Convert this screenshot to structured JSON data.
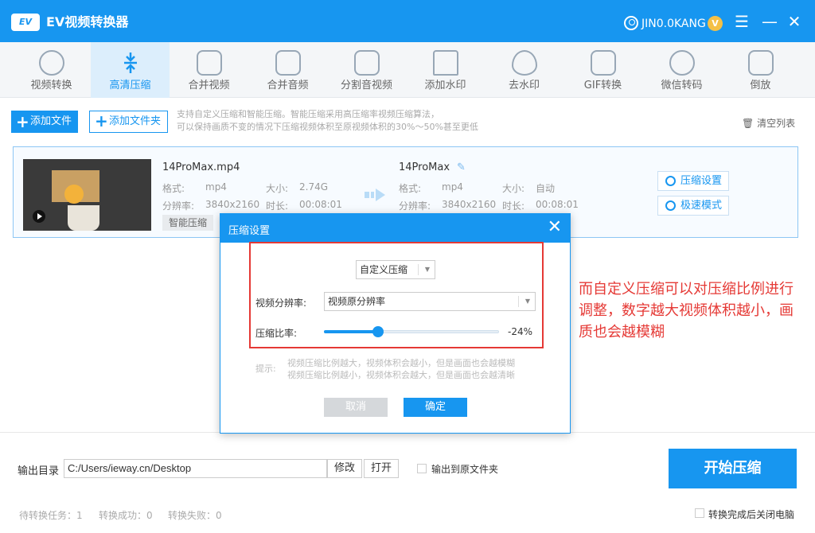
{
  "app": {
    "logo": "EV",
    "title": "EV视频转换器",
    "username": "JIN0.0KANG",
    "vip": "V"
  },
  "toolbar": {
    "items": [
      {
        "label": "视频转换",
        "icon": "video-convert-icon"
      },
      {
        "label": "高清压缩",
        "icon": "compress-icon"
      },
      {
        "label": "合并视频",
        "icon": "merge-video-icon"
      },
      {
        "label": "合并音频",
        "icon": "merge-audio-icon"
      },
      {
        "label": "分割音视频",
        "icon": "split-icon"
      },
      {
        "label": "添加水印",
        "icon": "watermark-add-icon"
      },
      {
        "label": "去水印",
        "icon": "watermark-remove-icon"
      },
      {
        "label": "GIF转换",
        "icon": "gif-icon"
      },
      {
        "label": "微信转码",
        "icon": "wechat-icon"
      },
      {
        "label": "倒放",
        "icon": "reverse-icon"
      }
    ],
    "active_index": 1
  },
  "actions": {
    "add_file": "添加文件",
    "add_folder": "添加文件夹",
    "desc_line1": "支持自定义压缩和智能压缩。智能压缩采用高压缩率视频压缩算法，",
    "desc_line2": "可以保持画质不变的情况下压缩视频体积至原视频体积的30%～50%甚至更低",
    "clear_list": "清空列表"
  },
  "file": {
    "source": {
      "name": "14ProMax.mp4",
      "format_label": "格式:",
      "format": "mp4",
      "size_label": "大小:",
      "size": "2.74G",
      "resolution_label": "分辨率:",
      "resolution": "3840x2160",
      "duration_label": "时长:",
      "duration": "00:08:01"
    },
    "mode_tag": "智能压缩",
    "output": {
      "name": "14ProMax",
      "format_label": "格式:",
      "format": "mp4",
      "size_label": "大小:",
      "size": "自动",
      "resolution_label": "分辨率:",
      "resolution": "3840x2160",
      "duration_label": "时长:",
      "duration": "00:08:01"
    },
    "compress_settings_btn": "压缩设置",
    "fast_mode_btn": "极速模式"
  },
  "dialog": {
    "title": "压缩设置",
    "mode_select": "自定义压缩",
    "resolution_label": "视频分辨率:",
    "resolution_value": "视频原分辨率",
    "ratio_label": "压缩比率:",
    "ratio_value": "-24%",
    "ratio_fraction": 0.31,
    "tip_label": "提示:",
    "tip_line1": "视频压缩比例越大，视频体积会越小，但是画面也会越模糊",
    "tip_line2": "视频压缩比例越小，视频体积会越大，但是画面也会越清晰",
    "cancel": "取消",
    "confirm": "确定"
  },
  "annotation": "而自定义压缩可以对压缩比例进行调整，数字越大视频体积越小，画质也会越模糊",
  "bottom": {
    "output_dir_label": "输出目录",
    "output_dir_value": "C:/Users/ieway.cn/Desktop",
    "modify": "修改",
    "open": "打开",
    "to_source_folder": "输出到原文件夹",
    "start": "开始压缩",
    "pending": "待转换任务：1",
    "success": "转换成功：0",
    "failed": "转换失败：0",
    "shutdown": "转换完成后关闭电脑"
  },
  "colors": {
    "accent": "#1796f0",
    "annotation": "#e53935"
  }
}
